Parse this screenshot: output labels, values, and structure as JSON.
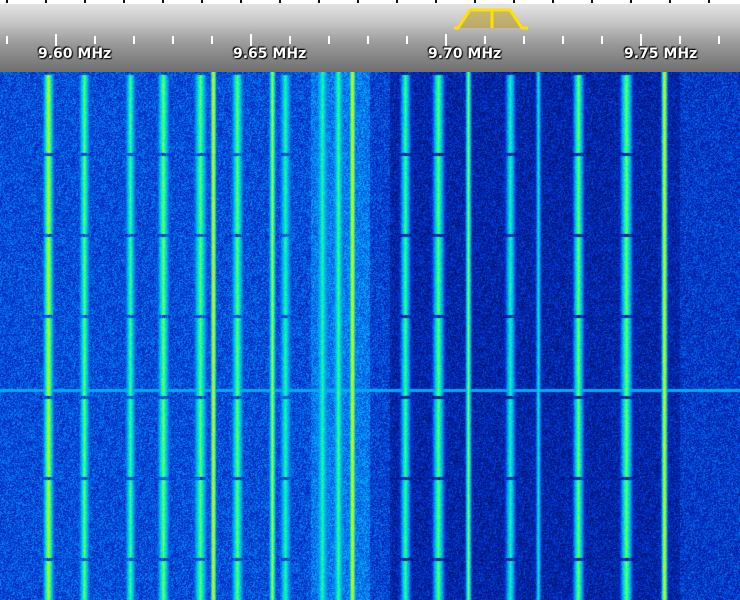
{
  "frequency_scale": {
    "unit": "MHz",
    "labels": [
      "9.60 MHz",
      "9.65 MHz",
      "9.70 MHz",
      "9.75 MHz"
    ]
  },
  "passband_marker": {
    "color": "#ffe000",
    "icon": "passband-filter-icon"
  },
  "waterfall": {
    "palette": [
      "#000a3c",
      "#0028c8",
      "#00a0ff",
      "#00ffb0",
      "#c8ff00",
      "#ffd200"
    ],
    "background_color": "#0a2a9a"
  }
}
